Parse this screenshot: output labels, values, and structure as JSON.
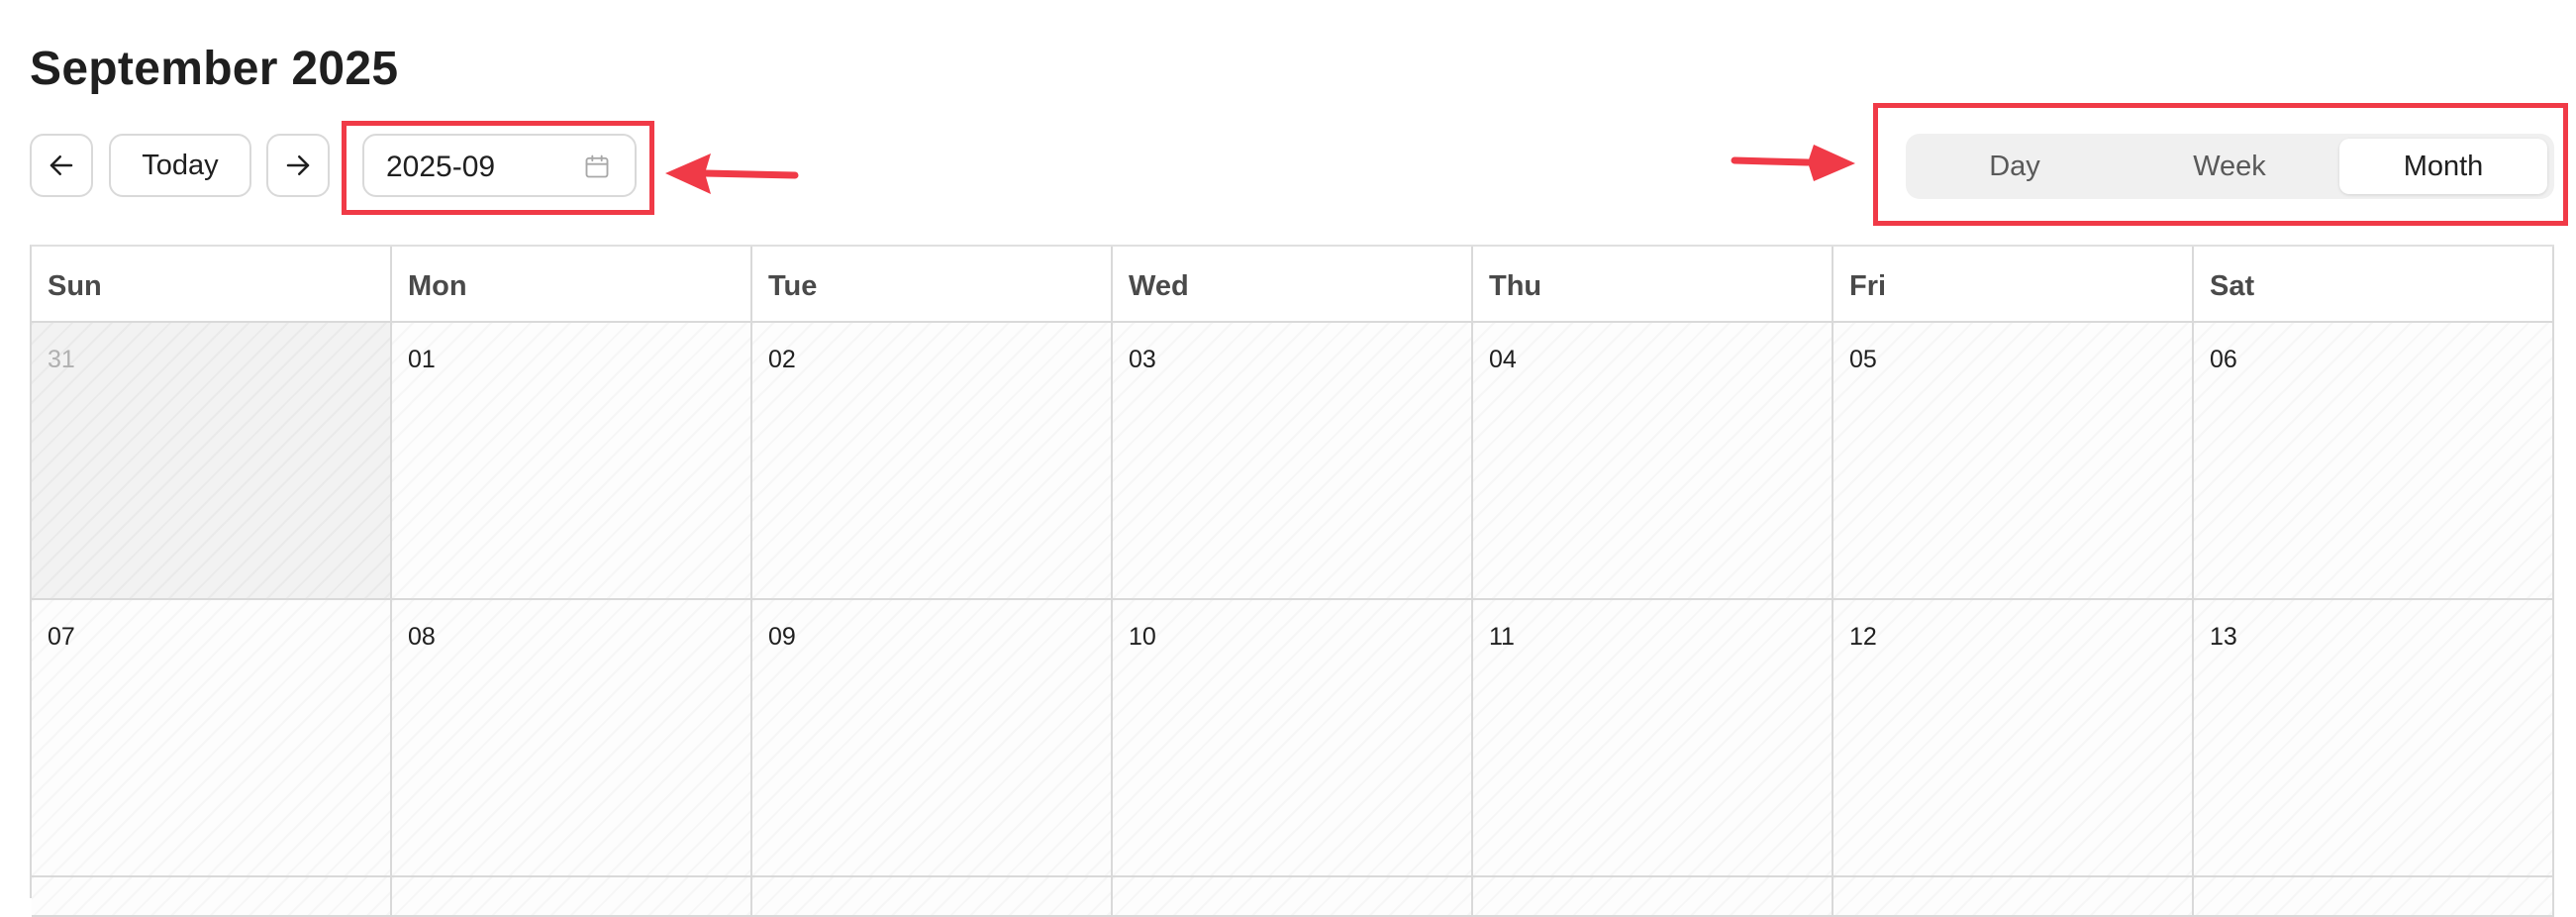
{
  "header": {
    "title": "September 2025",
    "today_label": "Today",
    "month_value": "2025-09"
  },
  "view_switch": {
    "options": [
      "Day",
      "Week",
      "Month"
    ],
    "selected": "Month"
  },
  "calendar": {
    "weekdays": [
      "Sun",
      "Mon",
      "Tue",
      "Wed",
      "Thu",
      "Fri",
      "Sat"
    ],
    "weeks": [
      [
        "31",
        "01",
        "02",
        "03",
        "04",
        "05",
        "06"
      ],
      [
        "07",
        "08",
        "09",
        "10",
        "11",
        "12",
        "13"
      ]
    ],
    "out_of_month_days": [
      "31"
    ]
  },
  "annotations": {
    "highlight_color": "#f03a47"
  },
  "icons": {
    "prev": "arrow-left-icon",
    "next": "arrow-right-icon",
    "picker": "calendar-icon"
  }
}
